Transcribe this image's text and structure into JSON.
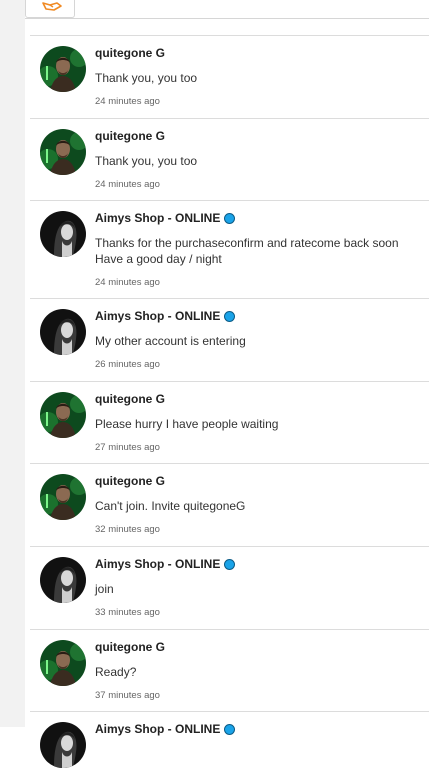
{
  "messages": [
    {
      "sender": "quitegone G",
      "text": "Thank you, you too",
      "time": "24 minutes ago",
      "online": false,
      "avatar": "quitegone-avatar"
    },
    {
      "sender": "quitegone G",
      "text": "Thank you, you too",
      "time": "24 minutes ago",
      "online": false,
      "avatar": "quitegone-avatar"
    },
    {
      "sender": "Aimys Shop - ONLINE",
      "text": "Thanks for the purchaseconfirm and ratecome back soon\nHave a good day / night",
      "time": "24 minutes ago",
      "online": true,
      "avatar": "aimys-avatar"
    },
    {
      "sender": "Aimys Shop - ONLINE",
      "text": "My other account is entering",
      "time": "26 minutes ago",
      "online": true,
      "avatar": "aimys-avatar"
    },
    {
      "sender": "quitegone G",
      "text": "Please hurry I have people waiting",
      "time": "27 minutes ago",
      "online": false,
      "avatar": "quitegone-avatar"
    },
    {
      "sender": "quitegone G",
      "text": "Can't join. Invite quitegoneG",
      "time": "32 minutes ago",
      "online": false,
      "avatar": "quitegone-avatar"
    },
    {
      "sender": "Aimys Shop - ONLINE",
      "text": "join",
      "time": "33 minutes ago",
      "online": true,
      "avatar": "aimys-avatar"
    },
    {
      "sender": "quitegone G",
      "text": "Ready?",
      "time": "37 minutes ago",
      "online": false,
      "avatar": "quitegone-avatar"
    },
    {
      "sender": "Aimys Shop - ONLINE",
      "text": "",
      "time": "",
      "online": true,
      "avatar": "aimys-avatar"
    }
  ],
  "colors": {
    "online_dot": "#1aa3e8",
    "accent_icon": "#f08a24"
  }
}
